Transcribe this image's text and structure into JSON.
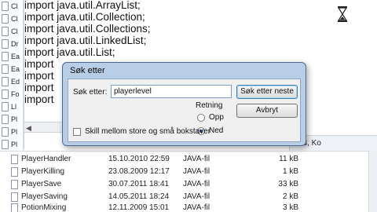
{
  "code_lines": [
    "import java.util.ArrayList;",
    "import java.util.Collection;",
    "import java.util.Collections;",
    "import java.util.LinkedList;",
    "import java.util.List;",
    "import",
    "import",
    "import",
    "import"
  ],
  "left_strip": [
    "Cl",
    "Cl",
    "Cl",
    "Dr",
    "Ea",
    "Ea",
    "Ed",
    "Fo",
    "Ll",
    "Pl",
    "Pl",
    "Pl"
  ],
  "status": {
    "text": "Li 3, Ko"
  },
  "dialog": {
    "title": "Søk etter",
    "find_label": "Søk etter:",
    "find_value": "playerlevel",
    "find_next_label": "Søk etter neste",
    "cancel_label": "Avbryt",
    "direction_label": "Retning",
    "up_label": "Opp",
    "down_label": "Ned",
    "direction_selected": "down",
    "match_case_label": "Skill mellom store og små bokstaver",
    "match_case_checked": false
  },
  "files": [
    {
      "name": "PlayerHandler",
      "date": "15.10.2010 22:59",
      "type": "JAVA-fil",
      "size": "11 kB"
    },
    {
      "name": "PlayerKilling",
      "date": "23.08.2009 12:17",
      "type": "JAVA-fil",
      "size": "1 kB"
    },
    {
      "name": "PlayerSave",
      "date": "30.07.2011 18:41",
      "type": "JAVA-fil",
      "size": "33 kB"
    },
    {
      "name": "PlayerSaving",
      "date": "14.05.2011 18:24",
      "type": "JAVA-fil",
      "size": "2 kB"
    },
    {
      "name": "PotionMixing",
      "date": "12.11.2009 15:01",
      "type": "JAVA-fil",
      "size": "3 kB"
    }
  ]
}
